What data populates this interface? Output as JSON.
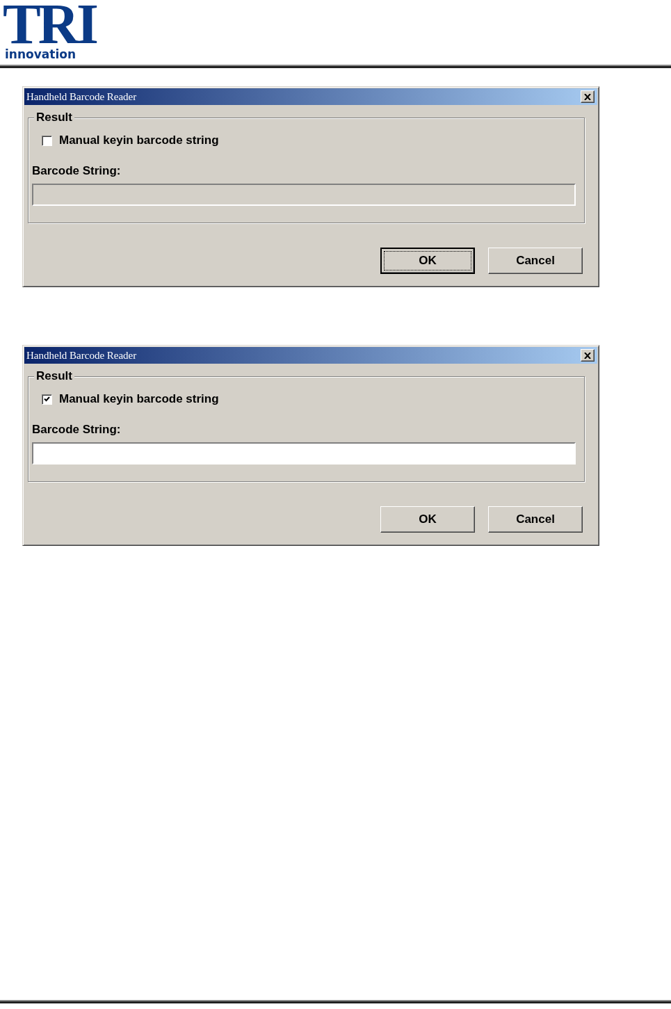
{
  "header": {
    "logo_mark": "TRI",
    "logo_text": "innovation"
  },
  "dialogs": [
    {
      "title": "Handheld Barcode Reader",
      "group_label": "Result",
      "checkbox": {
        "label": "Manual keyin barcode string",
        "checked": false
      },
      "field_label": "Barcode String:",
      "field": {
        "disabled": true
      },
      "buttons": [
        {
          "label": "OK",
          "focused": true
        },
        {
          "label": "Cancel",
          "focused": false
        }
      ]
    },
    {
      "title": "Handheld Barcode Reader",
      "group_label": "Result",
      "checkbox": {
        "label": "Manual keyin barcode string",
        "checked": true
      },
      "field_label": "Barcode String:",
      "field": {
        "disabled": false
      },
      "buttons": [
        {
          "label": "OK",
          "focused": false
        },
        {
          "label": "Cancel",
          "focused": false
        }
      ]
    }
  ]
}
